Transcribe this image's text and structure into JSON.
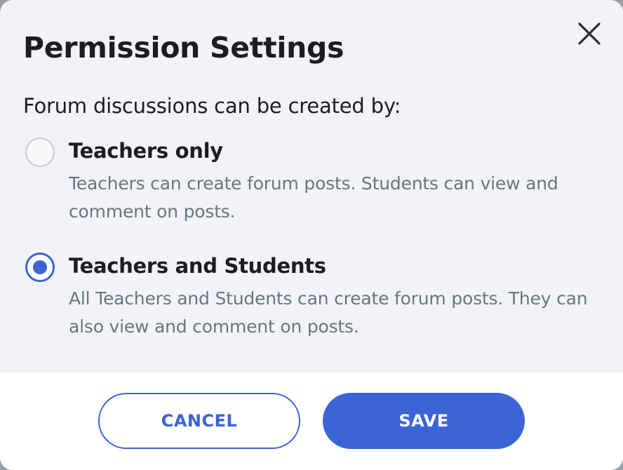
{
  "dialog": {
    "title": "Permission Settings",
    "close_icon": "close-icon",
    "prompt": "Forum discussions can be created by:"
  },
  "options": [
    {
      "label": "Teachers only",
      "description": "Teachers can create forum posts. Students can view and comment on posts.",
      "selected": false
    },
    {
      "label": "Teachers and Students",
      "description": "All Teachers and Students can create forum posts. They can also view and comment on posts.",
      "selected": true
    }
  ],
  "buttons": {
    "cancel": "CANCEL",
    "save": "SAVE"
  },
  "colors": {
    "accent": "#3b64d4",
    "background": "#f1f3f7",
    "text": "#1c1d20",
    "muted": "#6d7480"
  }
}
